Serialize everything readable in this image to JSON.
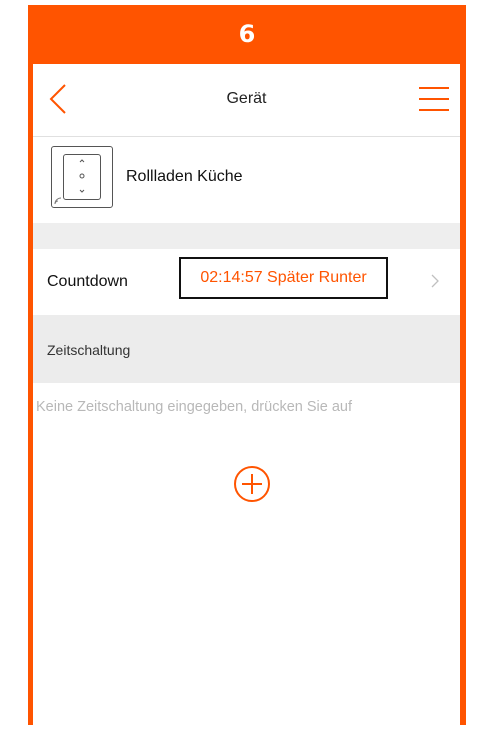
{
  "step_number": "6",
  "header": {
    "title": "Gerät",
    "back_icon": "chevron-left-icon",
    "menu_icon": "hamburger-menu-icon"
  },
  "device": {
    "name": "Rollladen Küche",
    "icon": "shutter-switch-icon"
  },
  "countdown": {
    "label": "Countdown",
    "value": "02:14:57 Später Runter",
    "arrow_icon": "chevron-right-icon"
  },
  "schedule": {
    "section_title": "Zeitschaltung",
    "empty_text": "Keine Zeitschaltung eingegeben, drücken Sie auf",
    "add_icon": "plus-circle-icon"
  },
  "colors": {
    "accent": "#ff5400",
    "separator": "#eeeeee",
    "muted_text": "#b8b8b8"
  }
}
